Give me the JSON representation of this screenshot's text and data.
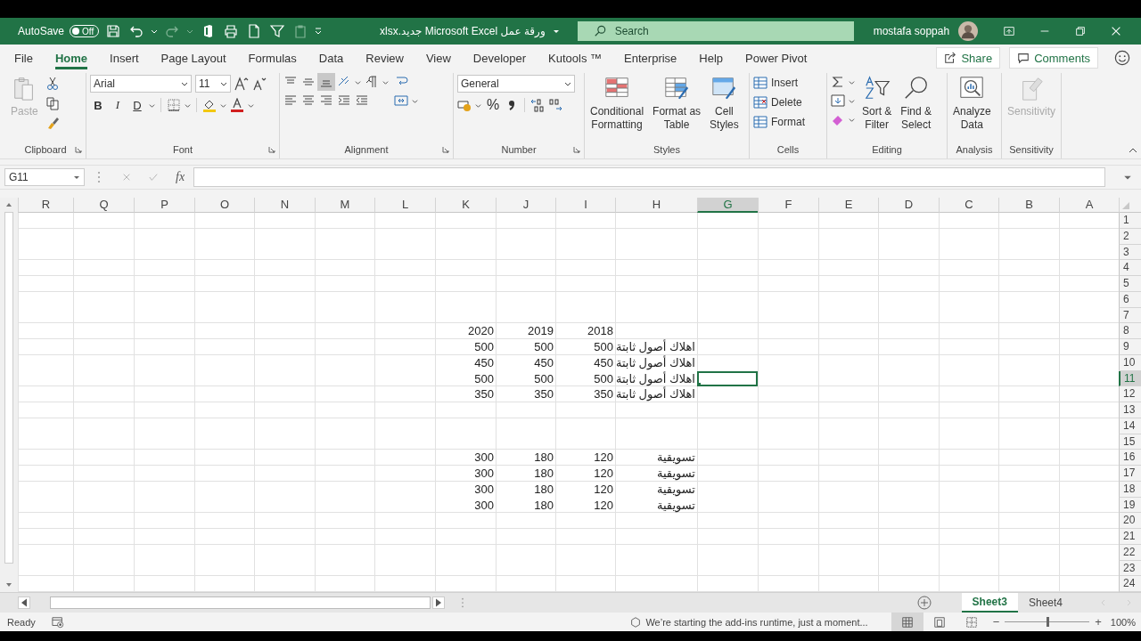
{
  "title_bar": {
    "autosave": {
      "label": "AutoSave",
      "state": "Off",
      "on": false
    },
    "document_title": "ورقة عمل Microsoft Excel جديد.xlsx",
    "search": {
      "placeholder": "Search"
    },
    "user": "mostafa soppah"
  },
  "menu_tabs": [
    {
      "label": "File",
      "selected": false
    },
    {
      "label": "Home",
      "selected": true
    },
    {
      "label": "Insert",
      "selected": false
    },
    {
      "label": "Page Layout",
      "selected": false
    },
    {
      "label": "Formulas",
      "selected": false
    },
    {
      "label": "Data",
      "selected": false
    },
    {
      "label": "Review",
      "selected": false
    },
    {
      "label": "View",
      "selected": false
    },
    {
      "label": "Developer",
      "selected": false
    },
    {
      "label": "Kutools ™",
      "selected": false
    },
    {
      "label": "Enterprise",
      "selected": false
    },
    {
      "label": "Help",
      "selected": false
    },
    {
      "label": "Power Pivot",
      "selected": false
    }
  ],
  "share": "Share",
  "comments": "Comments",
  "ribbon": {
    "clipboard": {
      "title": "Clipboard",
      "paste": {
        "label": "Paste",
        "disabled": true
      }
    },
    "font": {
      "title": "Font",
      "family": "Arial",
      "size": "11",
      "bold": "B",
      "italic": "I",
      "underline": "D"
    },
    "alignment": {
      "title": "Alignment"
    },
    "number": {
      "title": "Number",
      "format": "General",
      "percent": "%"
    },
    "styles": {
      "title": "Styles",
      "buttons": [
        {
          "kind": "conditional",
          "lines": [
            "Conditional",
            "Formatting"
          ]
        },
        {
          "kind": "table",
          "lines": [
            "Format as",
            "Table"
          ]
        },
        {
          "kind": "cellstyles",
          "lines": [
            "Cell",
            "Styles"
          ]
        }
      ]
    },
    "cells": {
      "title": "Cells",
      "buttons": [
        {
          "kind": "insert",
          "label": "Insert"
        },
        {
          "kind": "delete",
          "label": "Delete"
        },
        {
          "kind": "format",
          "label": "Format"
        }
      ]
    },
    "editing": {
      "title": "Editing",
      "buttons": [
        {
          "kind": "sort",
          "lines": [
            "Sort &",
            "Filter"
          ]
        },
        {
          "kind": "find",
          "lines": [
            "Find &",
            "Select"
          ]
        }
      ]
    },
    "analysis": {
      "title": "Analysis",
      "lines": [
        "Analyze",
        "Data"
      ]
    },
    "sensitivity": {
      "title": "Sensitivity",
      "label": "Sensitivity",
      "disabled": true
    }
  },
  "formula_bar": {
    "name_box": "G11",
    "function_label": "fx"
  },
  "sheet": {
    "columns": [
      {
        "label": "R",
        "selected": false
      },
      {
        "label": "Q",
        "selected": false
      },
      {
        "label": "P",
        "selected": false
      },
      {
        "label": "O",
        "selected": false
      },
      {
        "label": "N",
        "selected": false
      },
      {
        "label": "M",
        "selected": false
      },
      {
        "label": "L",
        "selected": false
      },
      {
        "label": "K",
        "selected": false
      },
      {
        "label": "J",
        "selected": false
      },
      {
        "label": "I",
        "selected": false
      },
      {
        "label": "H",
        "selected": false
      },
      {
        "label": "G",
        "selected": true
      },
      {
        "label": "F",
        "selected": false
      },
      {
        "label": "E",
        "selected": false
      },
      {
        "label": "D",
        "selected": false
      },
      {
        "label": "C",
        "selected": false
      },
      {
        "label": "B",
        "selected": false
      },
      {
        "label": "A",
        "selected": false
      }
    ],
    "rows": [
      {
        "number": "1",
        "selected": false
      },
      {
        "number": "2",
        "selected": false
      },
      {
        "number": "3",
        "selected": false
      },
      {
        "number": "4",
        "selected": false
      },
      {
        "number": "5",
        "selected": false
      },
      {
        "number": "6",
        "selected": false
      },
      {
        "number": "7",
        "selected": false
      },
      {
        "number": "8",
        "selected": false,
        "cells": [
          "2020",
          "2019",
          "2018"
        ]
      },
      {
        "number": "9",
        "selected": false,
        "cells": [
          "500",
          "500",
          "500",
          "اهلاك أصول ثابتة"
        ]
      },
      {
        "number": "10",
        "selected": false,
        "cells": [
          "450",
          "450",
          "450",
          "اهلاك أصول ثابتة"
        ]
      },
      {
        "number": "11",
        "selected": true,
        "cells": [
          "500",
          "500",
          "500",
          "اهلاك أصول ثابتة"
        ]
      },
      {
        "number": "12",
        "selected": false,
        "cells": [
          "350",
          "350",
          "350",
          "اهلاك أصول ثابتة"
        ]
      },
      {
        "number": "13",
        "selected": false
      },
      {
        "number": "14",
        "selected": false
      },
      {
        "number": "15",
        "selected": false
      },
      {
        "number": "16",
        "selected": false,
        "cells": [
          "300",
          "180",
          "120",
          "تسويقية"
        ]
      },
      {
        "number": "17",
        "selected": false,
        "cells": [
          "300",
          "180",
          "120",
          "تسويقية"
        ]
      },
      {
        "number": "18",
        "selected": false,
        "cells": [
          "300",
          "180",
          "120",
          "تسويقية"
        ]
      },
      {
        "number": "19",
        "selected": false,
        "cells": [
          "300",
          "180",
          "120",
          "تسويقية"
        ]
      },
      {
        "number": "20",
        "selected": false
      },
      {
        "number": "21",
        "selected": false
      },
      {
        "number": "22",
        "selected": false
      },
      {
        "number": "23",
        "selected": false
      },
      {
        "number": "24",
        "selected": false
      }
    ]
  },
  "sheet_tabs": [
    {
      "label": "Sheet3",
      "selected": true
    },
    {
      "label": "Sheet4",
      "selected": false
    }
  ],
  "status_bar": {
    "ready": "Ready",
    "message": "We’re starting the add-ins runtime, just a moment...",
    "views": [
      {
        "kind": "normal",
        "selected": true
      },
      {
        "kind": "page_layout",
        "selected": false
      },
      {
        "kind": "page_break",
        "selected": false
      }
    ],
    "zoom": {
      "minus": "−",
      "plus": "+",
      "level": 0.5,
      "label": "100%"
    }
  }
}
